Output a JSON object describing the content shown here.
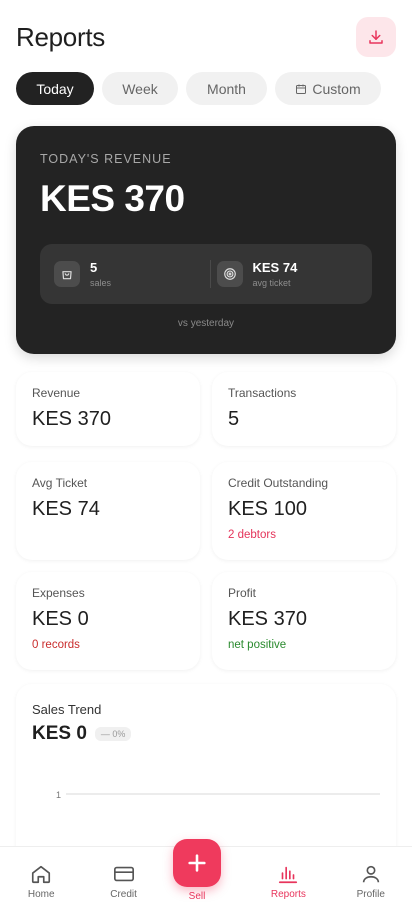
{
  "header": {
    "title": "Reports",
    "download_icon": "download-icon"
  },
  "tabs": [
    {
      "label": "Today",
      "active": true
    },
    {
      "label": "Week",
      "active": false
    },
    {
      "label": "Month",
      "active": false
    },
    {
      "label": "Custom",
      "active": false,
      "icon": "calendar-icon"
    }
  ],
  "hero": {
    "label": "TODAY'S REVENUE",
    "amount": "KES 370",
    "sales_value": "5",
    "sales_label": "sales",
    "avg_value": "KES 74",
    "avg_label": "avg ticket",
    "compare": "vs yesterday"
  },
  "metrics": {
    "revenue": {
      "label": "Revenue",
      "value": "KES 370"
    },
    "transactions": {
      "label": "Transactions",
      "value": "5"
    },
    "avg_ticket": {
      "label": "Avg Ticket",
      "value": "KES 74"
    },
    "credit": {
      "label": "Credit Outstanding",
      "value": "KES 100",
      "sub": "2 debtors"
    },
    "expenses": {
      "label": "Expenses",
      "value": "KES 0",
      "sub": "0 records"
    },
    "profit": {
      "label": "Profit",
      "value": "KES 370",
      "sub": "net positive"
    }
  },
  "trend": {
    "title": "Sales Trend",
    "value": "KES 0",
    "change": "— 0%",
    "axis_tick": "1"
  },
  "nav": {
    "home": "Home",
    "credit": "Credit",
    "sell": "Sell",
    "reports": "Reports",
    "profile": "Profile"
  },
  "colors": {
    "accent": "#e8355c",
    "hero_bg": "#232323",
    "positive": "#2a8a2e"
  }
}
